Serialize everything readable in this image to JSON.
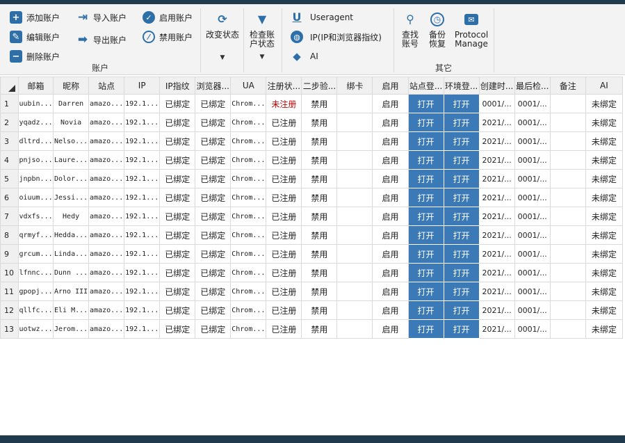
{
  "ribbon": {
    "account_group": {
      "label": "账户",
      "add": "添加账户",
      "edit": "编辑账户",
      "delete": "删除账户",
      "import": "导入账户",
      "export": "导出账户",
      "enable": "启用账户",
      "disable": "禁用账户"
    },
    "change_status": "改变状态",
    "check_status_line1": "检查账",
    "check_status_line2": "户状态",
    "useragent": "Useragent",
    "ip_fingerprint": "IP(IP和浏览器指纹)",
    "ai": "AI",
    "other_group": {
      "label": "其它",
      "find_line1": "查找",
      "find_line2": "账号",
      "backup_line1": "备份",
      "backup_line2": "恢复",
      "protocol_line1": "Protocol",
      "protocol_line2": "Manage"
    }
  },
  "columns": [
    "邮箱",
    "昵称",
    "站点",
    "IP",
    "IP指纹",
    "浏览器...",
    "UA",
    "注册状...",
    "二步验...",
    "绑卡",
    "启用",
    "站点登...",
    "环境登...",
    "创建时...",
    "最后检...",
    "备注",
    "AI"
  ],
  "rows": [
    {
      "n": "1",
      "email": "uubin...",
      "nick": "Darren",
      "site": "amazo...",
      "ip": "192.1...",
      "ipfp": "已绑定",
      "browser": "已绑定",
      "ua": "Chrom...",
      "reg": "未注册",
      "twofa": "禁用",
      "card": "",
      "enabled": "启用",
      "site_login": "打开",
      "env_login": "打开",
      "created": "0001/...",
      "last": "0001/...",
      "note": "",
      "ai": "未绑定"
    },
    {
      "n": "2",
      "email": "yqadz...",
      "nick": "Novia",
      "site": "amazo...",
      "ip": "192.1...",
      "ipfp": "已绑定",
      "browser": "已绑定",
      "ua": "Chrom...",
      "reg": "已注册",
      "twofa": "禁用",
      "card": "",
      "enabled": "启用",
      "site_login": "打开",
      "env_login": "打开",
      "created": "2021/...",
      "last": "0001/...",
      "note": "",
      "ai": "未绑定"
    },
    {
      "n": "3",
      "email": "dltrd...",
      "nick": "Nelso...",
      "site": "amazo...",
      "ip": "192.1...",
      "ipfp": "已绑定",
      "browser": "已绑定",
      "ua": "Chrom...",
      "reg": "已注册",
      "twofa": "禁用",
      "card": "",
      "enabled": "启用",
      "site_login": "打开",
      "env_login": "打开",
      "created": "2021/...",
      "last": "0001/...",
      "note": "",
      "ai": "未绑定"
    },
    {
      "n": "4",
      "email": "pnjso...",
      "nick": "Laure...",
      "site": "amazo...",
      "ip": "192.1...",
      "ipfp": "已绑定",
      "browser": "已绑定",
      "ua": "Chrom...",
      "reg": "已注册",
      "twofa": "禁用",
      "card": "",
      "enabled": "启用",
      "site_login": "打开",
      "env_login": "打开",
      "created": "2021/...",
      "last": "0001/...",
      "note": "",
      "ai": "未绑定"
    },
    {
      "n": "5",
      "email": "jnpbn...",
      "nick": "Dolor...",
      "site": "amazo...",
      "ip": "192.1...",
      "ipfp": "已绑定",
      "browser": "已绑定",
      "ua": "Chrom...",
      "reg": "已注册",
      "twofa": "禁用",
      "card": "",
      "enabled": "启用",
      "site_login": "打开",
      "env_login": "打开",
      "created": "2021/...",
      "last": "0001/...",
      "note": "",
      "ai": "未绑定"
    },
    {
      "n": "6",
      "email": "oiuum...",
      "nick": "Jessi...",
      "site": "amazo...",
      "ip": "192.1...",
      "ipfp": "已绑定",
      "browser": "已绑定",
      "ua": "Chrom...",
      "reg": "已注册",
      "twofa": "禁用",
      "card": "",
      "enabled": "启用",
      "site_login": "打开",
      "env_login": "打开",
      "created": "2021/...",
      "last": "0001/...",
      "note": "",
      "ai": "未绑定"
    },
    {
      "n": "7",
      "email": "vdxfs...",
      "nick": "Hedy",
      "site": "amazo...",
      "ip": "192.1...",
      "ipfp": "已绑定",
      "browser": "已绑定",
      "ua": "Chrom...",
      "reg": "已注册",
      "twofa": "禁用",
      "card": "",
      "enabled": "启用",
      "site_login": "打开",
      "env_login": "打开",
      "created": "2021/...",
      "last": "0001/...",
      "note": "",
      "ai": "未绑定"
    },
    {
      "n": "8",
      "email": "qrmyf...",
      "nick": "Hedda...",
      "site": "amazo...",
      "ip": "192.1...",
      "ipfp": "已绑定",
      "browser": "已绑定",
      "ua": "Chrom...",
      "reg": "已注册",
      "twofa": "禁用",
      "card": "",
      "enabled": "启用",
      "site_login": "打开",
      "env_login": "打开",
      "created": "2021/...",
      "last": "0001/...",
      "note": "",
      "ai": "未绑定"
    },
    {
      "n": "9",
      "email": "grcum...",
      "nick": "Linda...",
      "site": "amazo...",
      "ip": "192.1...",
      "ipfp": "已绑定",
      "browser": "已绑定",
      "ua": "Chrom...",
      "reg": "已注册",
      "twofa": "禁用",
      "card": "",
      "enabled": "启用",
      "site_login": "打开",
      "env_login": "打开",
      "created": "2021/...",
      "last": "0001/...",
      "note": "",
      "ai": "未绑定"
    },
    {
      "n": "10",
      "email": "lfnnc...",
      "nick": "Dunn ...",
      "site": "amazo...",
      "ip": "192.1...",
      "ipfp": "已绑定",
      "browser": "已绑定",
      "ua": "Chrom...",
      "reg": "已注册",
      "twofa": "禁用",
      "card": "",
      "enabled": "启用",
      "site_login": "打开",
      "env_login": "打开",
      "created": "2021/...",
      "last": "0001/...",
      "note": "",
      "ai": "未绑定"
    },
    {
      "n": "11",
      "email": "gpopj...",
      "nick": "Arno III",
      "site": "amazo...",
      "ip": "192.1...",
      "ipfp": "已绑定",
      "browser": "已绑定",
      "ua": "Chrom...",
      "reg": "已注册",
      "twofa": "禁用",
      "card": "",
      "enabled": "启用",
      "site_login": "打开",
      "env_login": "打开",
      "created": "2021/...",
      "last": "0001/...",
      "note": "",
      "ai": "未绑定"
    },
    {
      "n": "12",
      "email": "qllfc...",
      "nick": "Eli M...",
      "site": "amazo...",
      "ip": "192.1...",
      "ipfp": "已绑定",
      "browser": "已绑定",
      "ua": "Chrom...",
      "reg": "已注册",
      "twofa": "禁用",
      "card": "",
      "enabled": "启用",
      "site_login": "打开",
      "env_login": "打开",
      "created": "2021/...",
      "last": "0001/...",
      "note": "",
      "ai": "未绑定"
    },
    {
      "n": "13",
      "email": "uotwz...",
      "nick": "Jerom...",
      "site": "amazo...",
      "ip": "192.1...",
      "ipfp": "已绑定",
      "browser": "已绑定",
      "ua": "Chrom...",
      "reg": "已注册",
      "twofa": "禁用",
      "card": "",
      "enabled": "启用",
      "site_login": "打开",
      "env_login": "打开",
      "created": "2021/...",
      "last": "0001/...",
      "note": "",
      "ai": "未绑定"
    }
  ],
  "colors": {
    "accent": "#3b7ab7",
    "unregistered": "#c00000",
    "frame": "#1f3a4d"
  }
}
